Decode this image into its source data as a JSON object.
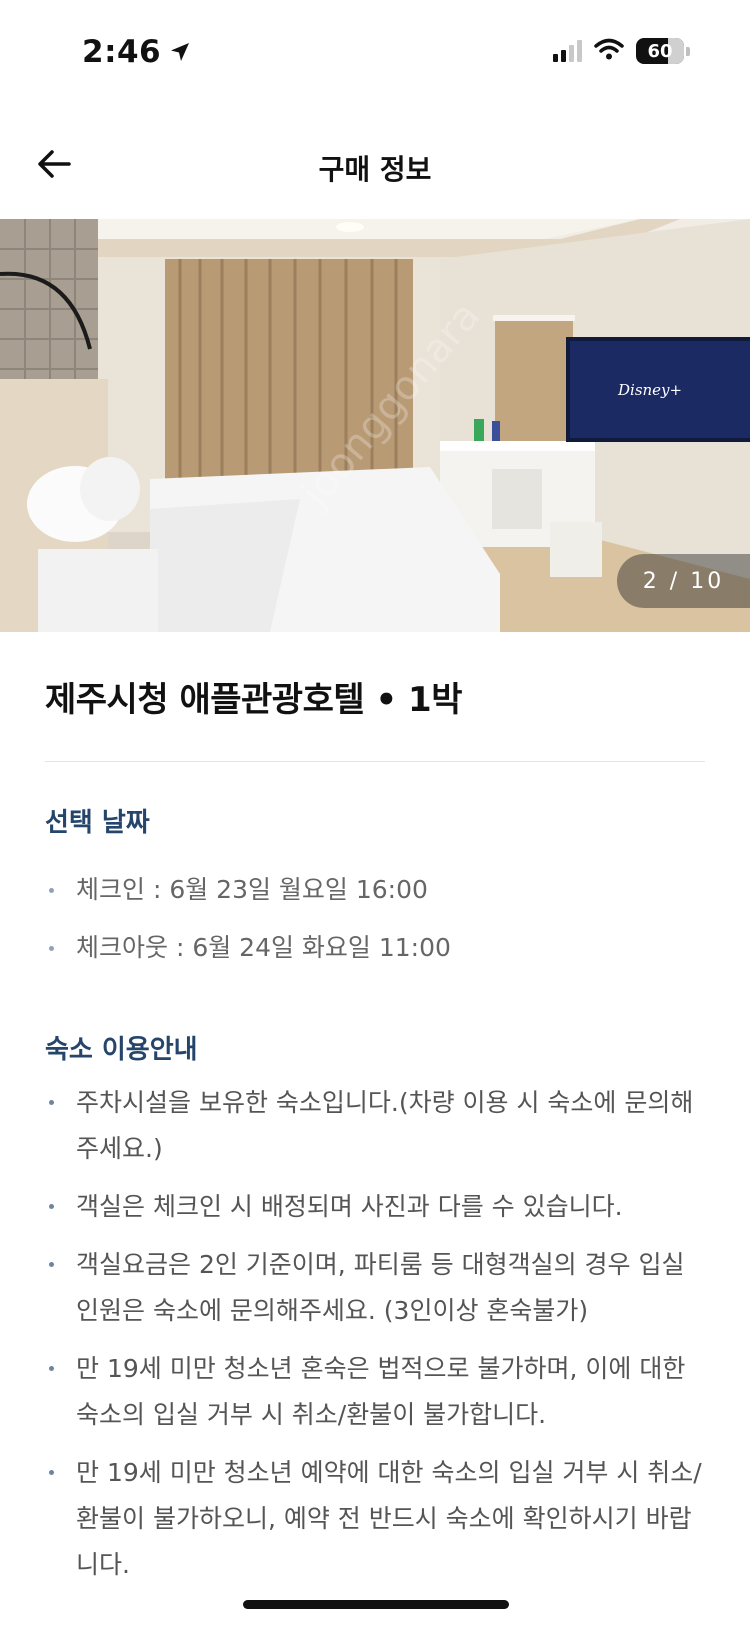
{
  "status_bar": {
    "time": "2:46",
    "battery": "60"
  },
  "header": {
    "title": "구매 정보"
  },
  "gallery": {
    "counter": "2 / 10",
    "current": 2,
    "total": 10
  },
  "hotel": {
    "title": "제주시청 애플관광호텔 • 1박"
  },
  "dates_section": {
    "title": "선택 날짜",
    "items": [
      "체크인 : 6월 23일 월요일 16:00",
      "체크아웃 : 6월 24일 화요일 11:00"
    ]
  },
  "info_section": {
    "title": "숙소 이용안내",
    "items": [
      "주차시설을 보유한 숙소입니다.(차량 이용 시 숙소에 문의해 주세요.)",
      "객실은 체크인 시 배정되며 사진과 다를 수 있습니다.",
      "객실요금은 2인 기준이며, 파티룸 등 대형객실의 경우 입실 인원은 숙소에 문의해주세요. (3인이상 혼숙불가)",
      "만 19세 미만 청소년 혼숙은 법적으로 불가하며, 이에 대한 숙소의 입실 거부 시 취소/환불이 불가합니다.",
      "만 19세 미만 청소년 예약에 대한 숙소의 입실 거부 시 취소/환불이 불가하오니, 예약 전 반드시 숙소에 확인하시기 바랍니다."
    ]
  },
  "colors": {
    "section_title": "#26456b",
    "bullet": "#8fa3b8",
    "body_text": "#555555"
  }
}
